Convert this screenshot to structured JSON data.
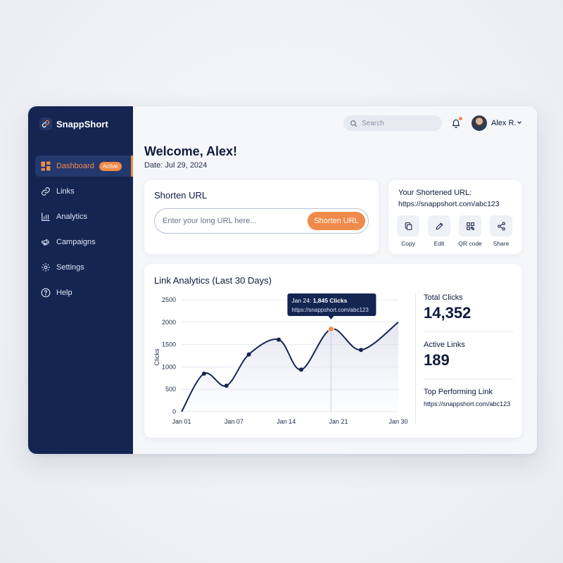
{
  "app": {
    "name": "SnappShort"
  },
  "sidebar": {
    "items": [
      {
        "label": "Dashboard",
        "icon": "dashboard-icon",
        "badge": "Active",
        "active": true
      },
      {
        "label": "Links",
        "icon": "link-icon"
      },
      {
        "label": "Analytics",
        "icon": "analytics-icon"
      },
      {
        "label": "Campaigns",
        "icon": "megaphone-icon"
      },
      {
        "label": "Settings",
        "icon": "gear-icon"
      },
      {
        "label": "Help",
        "icon": "help-icon"
      }
    ]
  },
  "topbar": {
    "search_placeholder": "Search",
    "user_name": "Alex R."
  },
  "header": {
    "welcome": "Welcome, Alex!",
    "date": "Date: Jul 29, 2024"
  },
  "shorten": {
    "title": "Shorten URL",
    "input_placeholder": "Enter your long URL here...",
    "button_label": "Shorten URL"
  },
  "result": {
    "label": "Your Shortened URL:",
    "url": "https://snappshort.com/abc123",
    "actions": [
      {
        "label": "Copy",
        "icon": "copy-icon"
      },
      {
        "label": "Edit",
        "icon": "pencil-icon"
      },
      {
        "label": "QR code",
        "icon": "qr-code-icon"
      },
      {
        "label": "Share",
        "icon": "share-icon"
      }
    ]
  },
  "analytics": {
    "title": "Link Analytics (Last 30 Days)",
    "stats": [
      {
        "label": "Total Clicks",
        "value": "14,352"
      },
      {
        "label": "Active Links",
        "value": "189"
      },
      {
        "label": "Top Performing Link",
        "value": "https://snappshort.com/abc123"
      }
    ]
  },
  "chart_data": {
    "type": "line",
    "title": "",
    "xlabel": "",
    "ylabel": "Clicks",
    "x_ticks": [
      "Jan 01",
      "Jan 07",
      "Jan 14",
      "Jan 21",
      "Jan 30"
    ],
    "y_ticks": [
      0,
      500,
      1000,
      1500,
      2000,
      2500
    ],
    "ylim": [
      0,
      2500
    ],
    "xlim": [
      1,
      30
    ],
    "grid": true,
    "series": [
      {
        "x": [
          1,
          4,
          7,
          10,
          14,
          17,
          21,
          25,
          30
        ],
        "y": [
          0,
          850,
          580,
          1280,
          1610,
          940,
          1845,
          1380,
          2000
        ]
      }
    ],
    "highlight": {
      "x": 21,
      "y": 1845
    },
    "tooltip": {
      "title": "Jan 24:",
      "value": "1,845 Clicks",
      "url": "https://snappshort.com/abc123"
    },
    "colors": {
      "line": "#142552",
      "highlight": "#f08a4b"
    }
  },
  "colors": {
    "accent": "#f08a4b",
    "sidebar": "#142552"
  }
}
